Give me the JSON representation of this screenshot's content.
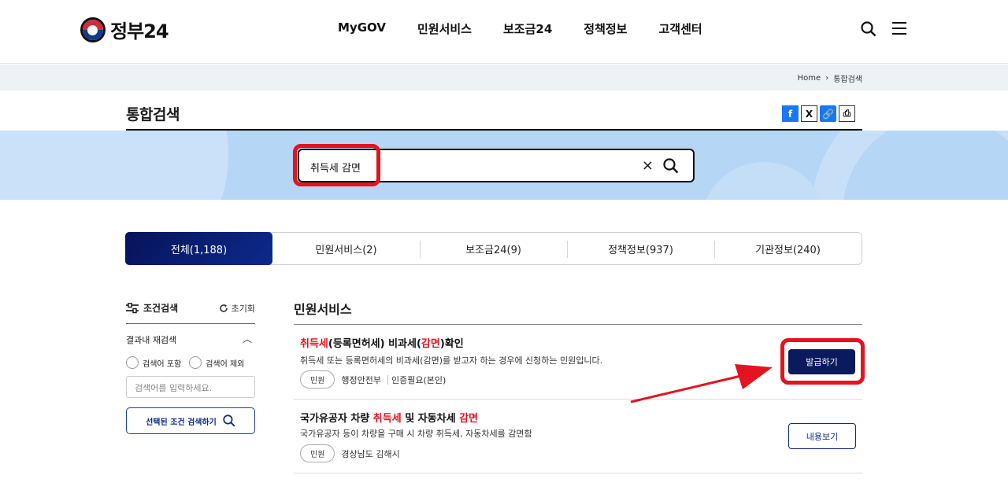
{
  "header": {
    "logo_text": "정부24",
    "nav": [
      "MyGOV",
      "민원서비스",
      "보조금24",
      "정책정보",
      "고객센터"
    ]
  },
  "breadcrumb": {
    "home": "Home",
    "current": "통합검색"
  },
  "page_title": "통합검색",
  "share": {
    "facebook": "f",
    "x": "X",
    "link": "🔗",
    "print": "⎙"
  },
  "search": {
    "value": "취득세 감면",
    "clear": "×"
  },
  "tabs": [
    {
      "label": "전체(1,188)",
      "active": true
    },
    {
      "label": "민원서비스(2)",
      "active": false
    },
    {
      "label": "보조금24(9)",
      "active": false
    },
    {
      "label": "정책정보(937)",
      "active": false
    },
    {
      "label": "기관정보(240)",
      "active": false
    }
  ],
  "filter": {
    "title": "조건검색",
    "reset": "초기화",
    "research_title": "결과내 재검색",
    "include": "검색어 포함",
    "exclude": "검색어 제외",
    "placeholder": "검색어를 입력하세요.",
    "button": "선택된 조건 검색하기"
  },
  "results": {
    "section_title": "민원서비스",
    "items": [
      {
        "title_parts": [
          "취득세",
          "(등록면허세) 비과세(",
          "감면",
          ")확인"
        ],
        "desc": "취득세 또는 등록면허세의 비과세(감면)를 받고자 하는 경우에 신청하는 민원입니다.",
        "badge": "민원",
        "org": "행정안전부",
        "auth": "인증필요(본인)",
        "button": "발급하기"
      },
      {
        "title_parts": [
          "국가유공자 차량 ",
          "취득세",
          " 및 자동차세 ",
          "감면"
        ],
        "desc": "국가유공자 등이 차량을 구매 시 차량 취득세, 자동차세를 감면함",
        "badge": "민원",
        "org": "경상남도 김해시",
        "button": "내용보기"
      }
    ]
  },
  "colors": {
    "accent": "#0a1a5c",
    "highlight": "#e3131f",
    "band": "#b6d6f6"
  }
}
